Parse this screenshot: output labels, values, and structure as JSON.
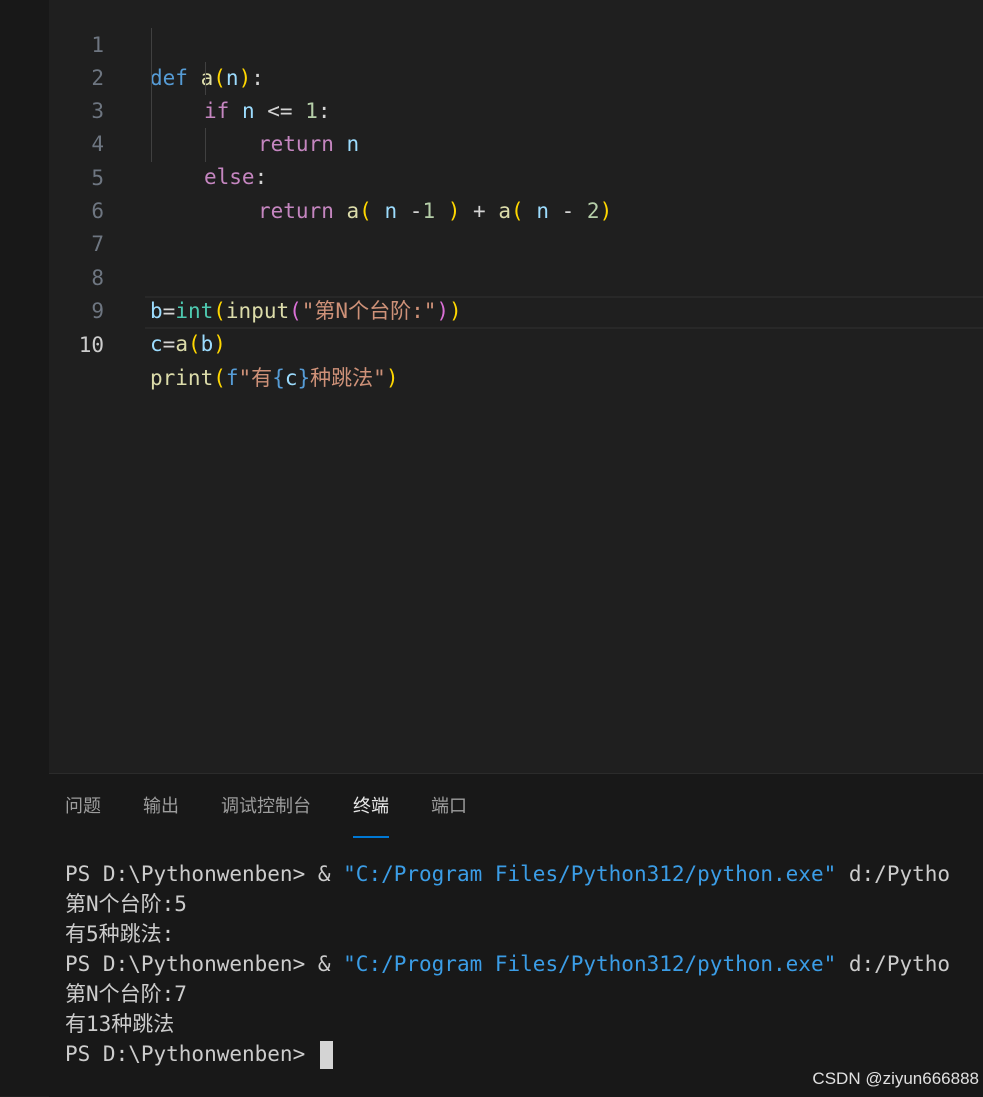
{
  "editor": {
    "lines": [
      {
        "num": "1"
      },
      {
        "num": "2"
      },
      {
        "num": "3"
      },
      {
        "num": "4"
      },
      {
        "num": "5"
      },
      {
        "num": "6"
      },
      {
        "num": "7"
      },
      {
        "num": "8"
      },
      {
        "num": "9"
      },
      {
        "num": "10"
      }
    ],
    "code": {
      "l1": [
        "def",
        " ",
        "a",
        "(",
        "n",
        ")",
        ":"
      ],
      "l2": [
        "if",
        " ",
        "n",
        " <= ",
        "1",
        ":"
      ],
      "l3": [
        "return",
        " ",
        "n"
      ],
      "l4": [
        "else",
        ":"
      ],
      "l5": [
        "return",
        " ",
        "a",
        "(",
        " ",
        "n",
        " -",
        "1",
        " ",
        ")",
        " + ",
        "a",
        "(",
        " ",
        "n",
        " - ",
        "2",
        ")"
      ],
      "l8": [
        "b",
        "=",
        "int",
        "(",
        "input",
        "(",
        "\"第N个台阶:\"",
        ")",
        ")"
      ],
      "l9": [
        "c",
        "=",
        "a",
        "(",
        "b",
        ")"
      ],
      "l10": [
        "print",
        "(",
        "f",
        "\"有",
        "{",
        "c",
        "}",
        "种跳法\"",
        ")"
      ]
    }
  },
  "panel": {
    "tabs": [
      "问题",
      "输出",
      "调试控制台",
      "终端",
      "端口"
    ],
    "active_tab": "终端",
    "terminal": [
      {
        "prompt": "PS D:\\Pythonwenben> & ",
        "str": "\"C:/Program Files/Python312/python.exe\"",
        "rest": " d:/Pytho"
      },
      {
        "text": "第N个台阶:5"
      },
      {
        "text": "有5种跳法:"
      },
      {
        "prompt": "PS D:\\Pythonwenben> & ",
        "str": "\"C:/Program Files/Python312/python.exe\"",
        "rest": " d:/Pytho"
      },
      {
        "text": "第N个台阶:7"
      },
      {
        "text": "有13种跳法"
      },
      {
        "prompt": "PS D:\\Pythonwenben> "
      }
    ]
  },
  "watermark": "CSDN @ziyun666888"
}
